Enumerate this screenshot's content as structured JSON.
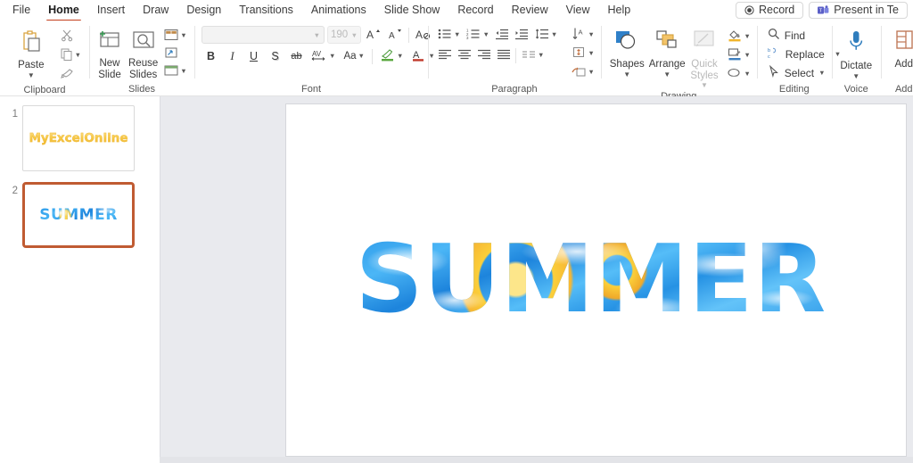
{
  "app": {
    "name": "Microsoft PowerPoint",
    "accent_color": "#c43e1c",
    "selection_color": "#c05b32"
  },
  "menubar": {
    "tabs": [
      {
        "label": "File",
        "active": false
      },
      {
        "label": "Home",
        "active": true
      },
      {
        "label": "Insert",
        "active": false
      },
      {
        "label": "Draw",
        "active": false
      },
      {
        "label": "Design",
        "active": false
      },
      {
        "label": "Transitions",
        "active": false
      },
      {
        "label": "Animations",
        "active": false
      },
      {
        "label": "Slide Show",
        "active": false
      },
      {
        "label": "Record",
        "active": false
      },
      {
        "label": "Review",
        "active": false
      },
      {
        "label": "View",
        "active": false
      },
      {
        "label": "Help",
        "active": false
      }
    ],
    "record_button": "Record",
    "present_button": "Present in Te"
  },
  "ribbon": {
    "groups": [
      {
        "name": "Clipboard",
        "label": "Clipboard"
      },
      {
        "name": "Slides",
        "label": "Slides"
      },
      {
        "name": "Font",
        "label": "Font"
      },
      {
        "name": "Paragraph",
        "label": "Paragraph"
      },
      {
        "name": "Drawing",
        "label": "Drawing"
      },
      {
        "name": "Editing",
        "label": "Editing"
      },
      {
        "name": "Voice",
        "label": "Voice"
      },
      {
        "name": "Add-ins",
        "label": "Add"
      }
    ],
    "clipboard": {
      "paste_label": "Paste",
      "cut_title": "Cut",
      "copy_title": "Copy",
      "format_painter_title": "Format Painter"
    },
    "slides": {
      "new_slide_label": "New Slide",
      "reuse_slides_label": "Reuse Slides",
      "layout_title": "Layout",
      "reset_title": "Reset",
      "section_title": "Section"
    },
    "font": {
      "font_name_value": "",
      "font_name_placeholder": "",
      "font_size_value": "190",
      "increase_size_title": "Increase Font Size",
      "decrease_size_title": "Decrease Font Size",
      "clear_formatting_title": "Clear All Formatting",
      "bold_label": "B",
      "italic_label": "I",
      "underline_label": "U",
      "shadow_label": "S",
      "strikethrough_label": "ab",
      "char_spacing_label": "AV",
      "change_case_label": "Aa",
      "text_highlight_title": "Text Highlight Color",
      "font_color_label": "A"
    },
    "paragraph": {
      "bullets_title": "Bullets",
      "numbering_title": "Numbering",
      "decrease_indent_title": "Decrease List Level",
      "increase_indent_title": "Increase List Level",
      "line_spacing_title": "Line Spacing",
      "align_left_title": "Align Left",
      "align_center_title": "Center",
      "align_right_title": "Align Right",
      "justify_title": "Justify",
      "columns_title": "Add or Remove Columns",
      "text_direction_title": "Text Direction",
      "align_text_title": "Align Text",
      "smartart_title": "Convert to SmartArt"
    },
    "drawing": {
      "shapes_label": "Shapes",
      "arrange_label": "Arrange",
      "quick_styles_label": "Quick Styles",
      "shape_fill_title": "Shape Fill",
      "shape_outline_title": "Shape Outline",
      "shape_effects_title": "Shape Effects"
    },
    "editing": {
      "find_label": "Find",
      "replace_label": "Replace",
      "select_label": "Select"
    },
    "voice": {
      "dictate_label": "Dictate"
    },
    "addins": {
      "addins_label": "Add"
    }
  },
  "thumbnails": [
    {
      "number": "1",
      "text": "MyExcelOnline",
      "selected": false
    },
    {
      "number": "2",
      "text": "SUMMER",
      "selected": true
    }
  ],
  "slide": {
    "wordart_text": "SUMMER"
  }
}
